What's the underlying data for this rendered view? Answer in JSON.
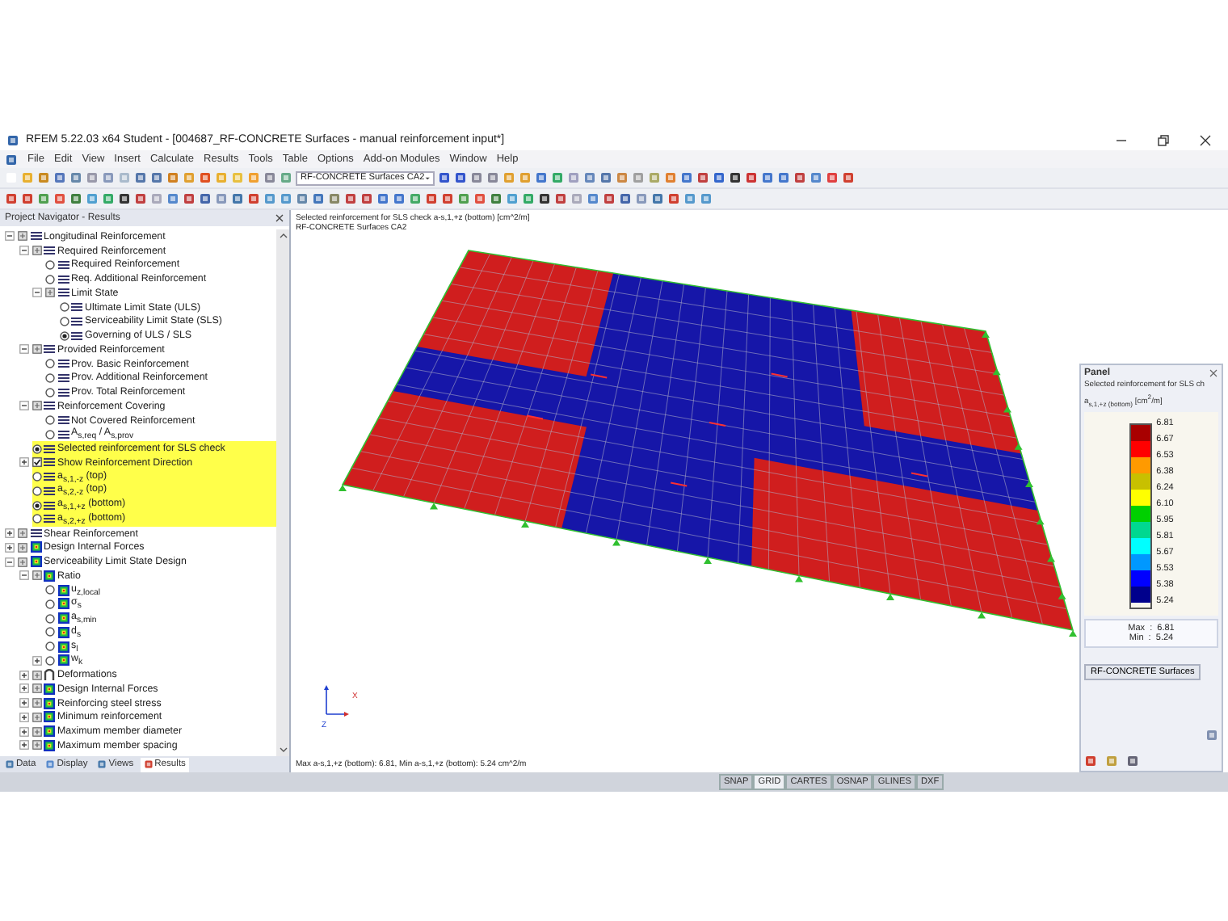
{
  "window": {
    "title": "RFEM 5.22.03 x64 Student - [004687_RF-CONCRETE Surfaces - manual reinforcement input*]"
  },
  "menu": [
    "File",
    "Edit",
    "View",
    "Insert",
    "Calculate",
    "Results",
    "Tools",
    "Table",
    "Options",
    "Add-on Modules",
    "Window",
    "Help"
  ],
  "toolbar": {
    "case_select": "RF-CONCRETE Surfaces CA2"
  },
  "navigator": {
    "title": "Project Navigator - Results",
    "tree": [
      {
        "label": "Longitudinal Reinforcement",
        "kind": "list-group",
        "expanded": true,
        "children": [
          {
            "label": "Required Reinforcement",
            "kind": "list-group",
            "expanded": true,
            "highlighted": false,
            "children": [
              {
                "label": "Required Reinforcement",
                "kind": "list-radio",
                "selected": false
              },
              {
                "label": "Req. Additional Reinforcement",
                "kind": "list-radio",
                "selected": false
              },
              {
                "label": "Limit State",
                "kind": "list-group",
                "expanded": true,
                "children": [
                  {
                    "label": "Ultimate Limit State (ULS)",
                    "kind": "list-radio",
                    "selected": false
                  },
                  {
                    "label": "Serviceability Limit State (SLS)",
                    "kind": "list-radio",
                    "selected": false
                  },
                  {
                    "label": "Governing of ULS / SLS",
                    "kind": "list-radio",
                    "selected": true
                  }
                ]
              }
            ]
          },
          {
            "label": "Provided Reinforcement",
            "kind": "list-group",
            "expanded": true,
            "highlighted": false,
            "children": [
              {
                "label": "Prov. Basic Reinforcement",
                "kind": "list-radio",
                "selected": false
              },
              {
                "label": "Prov. Additional Reinforcement",
                "kind": "list-radio",
                "selected": false
              },
              {
                "label": "Prov. Total Reinforcement",
                "kind": "list-radio",
                "selected": false
              }
            ]
          },
          {
            "label": "Reinforcement Covering",
            "kind": "list-group",
            "expanded": true,
            "highlighted": false,
            "children": [
              {
                "label": "Not Covered Reinforcement",
                "kind": "list-radio",
                "selected": false
              },
              {
                "label": "A$_{s,req}$ / A$_{s,prov}$",
                "kind": "list-radio",
                "selected": false
              }
            ]
          },
          {
            "label": "Selected reinforcement for SLS check",
            "kind": "list-radio",
            "selected": true,
            "highlighted": true
          },
          {
            "label": "Show Reinforcement Direction",
            "kind": "list-check",
            "checked": true,
            "expanded": false,
            "highlighted": true
          },
          {
            "label": "a$_{s,1,-z}$ (top)",
            "kind": "list-radio",
            "selected": false,
            "highlighted": true
          },
          {
            "label": "a$_{s,2,-z}$ (top)",
            "kind": "list-radio",
            "selected": false,
            "highlighted": true
          },
          {
            "label": "a$_{s,1,+z}$ (bottom)",
            "kind": "list-radio",
            "selected": true,
            "highlighted": true
          },
          {
            "label": "a$_{s,2,+z}$ (bottom)",
            "kind": "list-radio",
            "selected": false,
            "highlighted": true
          }
        ]
      },
      {
        "label": "Shear Reinforcement",
        "kind": "list-group",
        "expanded": false
      },
      {
        "label": "Design Internal Forces",
        "kind": "contour-group",
        "expanded": false
      },
      {
        "label": "Serviceability Limit State Design",
        "kind": "contour-group",
        "expanded": true,
        "children": [
          {
            "label": "Ratio",
            "kind": "contour-group",
            "expanded": true,
            "children": [
              {
                "label": "u$_{z,local}$",
                "kind": "contour-radio",
                "selected": false
              },
              {
                "label": "σ$_{s}$",
                "kind": "contour-radio",
                "selected": false
              },
              {
                "label": "a$_{s,min}$",
                "kind": "contour-radio",
                "selected": false
              },
              {
                "label": "d$_{s}$",
                "kind": "contour-radio",
                "selected": false
              },
              {
                "label": "s$_{l}$",
                "kind": "contour-radio",
                "selected": false
              },
              {
                "label": "w$_{k}$",
                "kind": "contour-radio",
                "selected": false,
                "expanded": false
              }
            ]
          },
          {
            "label": "Deformations",
            "kind": "deform-group",
            "expanded": false
          },
          {
            "label": "Design Internal Forces",
            "kind": "contour-group",
            "expanded": false
          },
          {
            "label": "Reinforcing steel stress",
            "kind": "contour-group",
            "expanded": false
          },
          {
            "label": "Minimum reinforcement",
            "kind": "contour-group",
            "expanded": false
          },
          {
            "label": "Maximum member diameter",
            "kind": "contour-group",
            "expanded": false
          },
          {
            "label": "Maximum member spacing",
            "kind": "contour-group",
            "expanded": false
          }
        ]
      }
    ],
    "tabs": [
      {
        "label": "Data",
        "selected": false
      },
      {
        "label": "Display",
        "selected": false
      },
      {
        "label": "Views",
        "selected": false
      },
      {
        "label": "Results",
        "selected": true
      }
    ]
  },
  "viewport": {
    "header": [
      "Selected reinforcement for SLS check a-s,1,+z (bottom) [cm^2/m]",
      "RF-CONCRETE Surfaces CA2"
    ],
    "axis_labels": [
      "X",
      "Z"
    ],
    "footer": "Max a-s,1,+z (bottom): 6.81, Min a-s,1,+z (bottom): 5.24 cm^2/m"
  },
  "panel": {
    "title": "Panel",
    "heading": "Selected reinforcement for SLS ch",
    "unit": "a$_{s,1,+z (bottom)}$ [cm$^{2}$/m]",
    "legend": {
      "labels": [
        "6.81",
        "6.67",
        "6.53",
        "6.38",
        "6.24",
        "6.10",
        "5.95",
        "5.81",
        "5.67",
        "5.53",
        "5.38",
        "5.24"
      ],
      "bands": [
        {
          "color": "#a80000"
        },
        {
          "color": "#ff0000"
        },
        {
          "color": "#ff9a00"
        },
        {
          "color": "#c8c000"
        },
        {
          "color": "#ffff00"
        },
        {
          "color": "#00d000"
        },
        {
          "color": "#00d890"
        },
        {
          "color": "#00ffff"
        },
        {
          "color": "#0098ff"
        },
        {
          "color": "#0000ff"
        },
        {
          "color": "#00008c"
        }
      ]
    },
    "max": "Max  :  6.81",
    "min": "Min  :  5.24",
    "button": "RF-CONCRETE Surfaces"
  },
  "status_bar": {
    "toggles": [
      {
        "label": "SNAP",
        "on": false
      },
      {
        "label": "GRID",
        "on": true
      },
      {
        "label": "CARTES",
        "on": false
      },
      {
        "label": "OSNAP",
        "on": false
      },
      {
        "label": "GLINES",
        "on": false
      },
      {
        "label": "DXF",
        "on": false
      }
    ]
  }
}
